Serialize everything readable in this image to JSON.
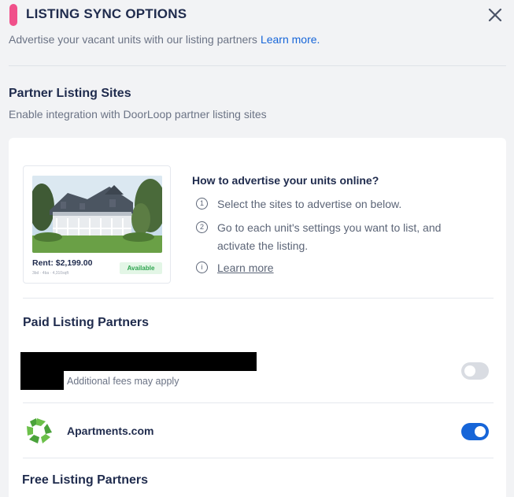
{
  "header": {
    "title": "LISTING SYNC OPTIONS",
    "subtitle": "Advertise your vacant units with our listing partners",
    "learn_more": "Learn more."
  },
  "partner_section": {
    "title": "Partner Listing Sites",
    "subtitle": "Enable integration with DoorLoop partner listing sites"
  },
  "preview_card": {
    "rent": "Rent: $2,199.00",
    "details": "3bd · 4ba · 4,310sqft",
    "status": "Available"
  },
  "howto": {
    "title": "How to advertise your units online?",
    "steps": [
      {
        "num": "1",
        "text": "Select the sites to advertise on below."
      },
      {
        "num": "2",
        "text": "Go to each unit's settings you want to list, and activate the listing."
      }
    ],
    "info_icon": "i",
    "learn_more": "Learn more"
  },
  "paid_partners": {
    "title": "Paid Listing Partners",
    "items": [
      {
        "name": "",
        "note": "Additional fees may apply",
        "enabled": false
      },
      {
        "name": "Apartments.com",
        "enabled": true
      }
    ]
  },
  "free_partners": {
    "title": "Free Listing Partners"
  },
  "colors": {
    "accent": "#f0508a",
    "link": "#1665d8",
    "toggle_on": "#1665d8",
    "toggle_off": "#d9dce2",
    "available": "#2ea44f"
  }
}
